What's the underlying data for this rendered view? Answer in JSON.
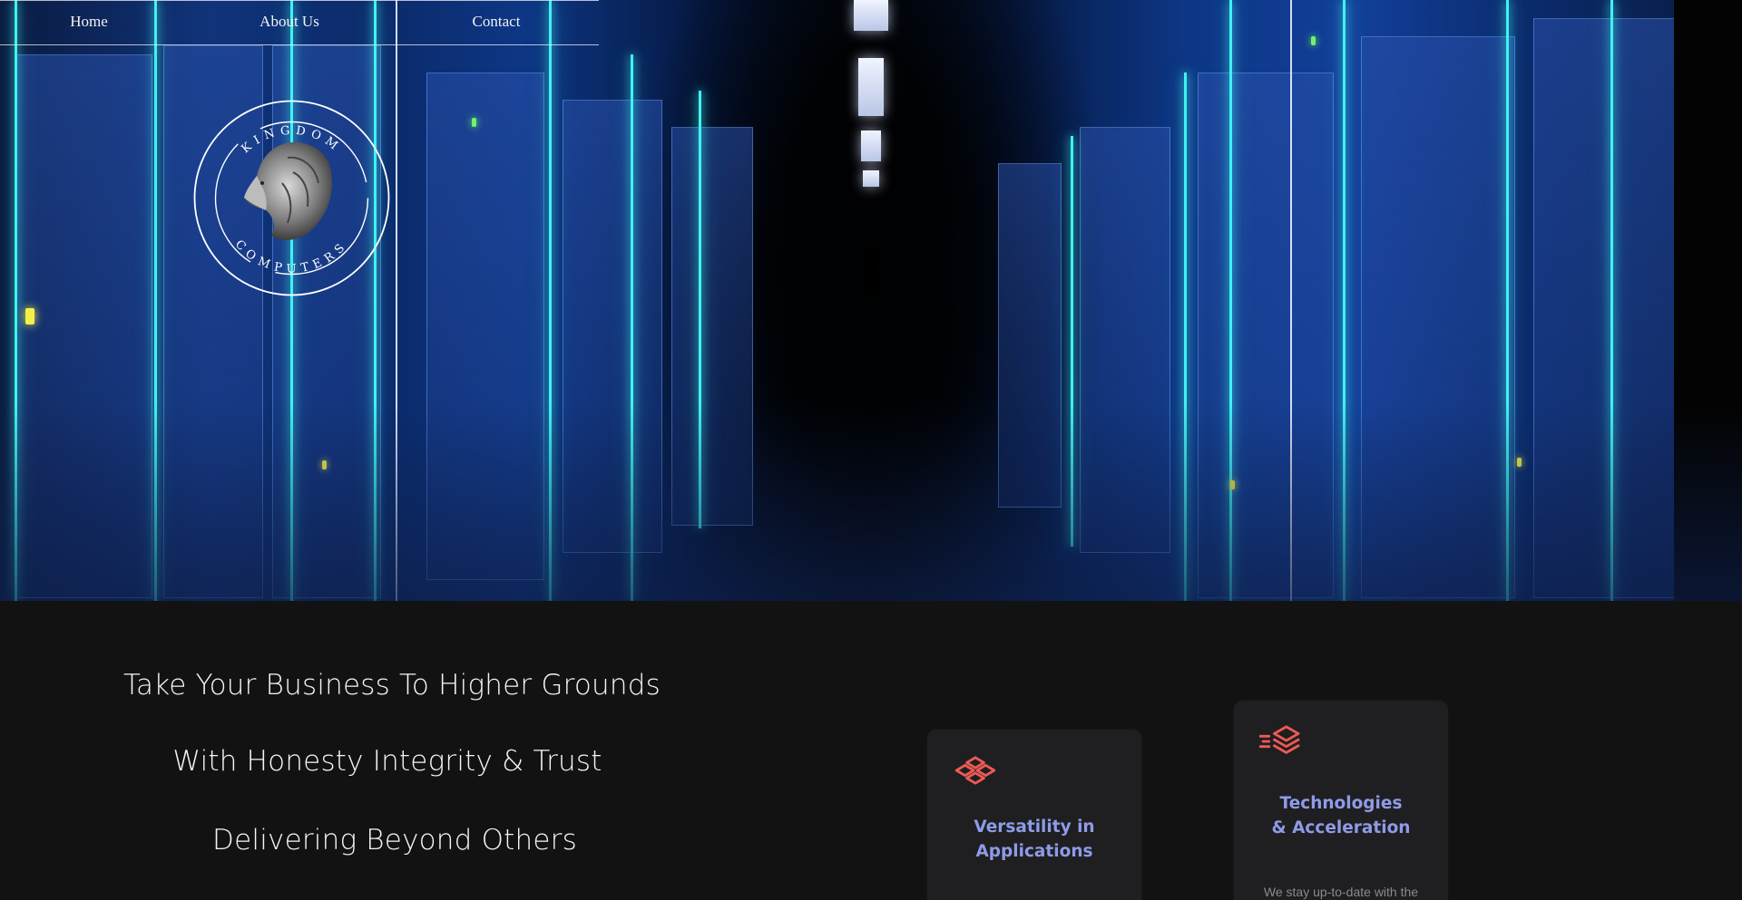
{
  "nav": {
    "items": [
      {
        "label": "Home"
      },
      {
        "label": "About Us"
      },
      {
        "label": "Contact"
      }
    ]
  },
  "logo": {
    "top_text": "KINGDOM",
    "bottom_text": "COMPUTERS",
    "icon": "lion-icon"
  },
  "hero": {
    "background": "server-room-image",
    "accent_color": "#3ff2f0"
  },
  "taglines": [
    "Take Your Business To Higher Grounds",
    "With Honesty Integrity & Trust",
    "Delivering Beyond Others"
  ],
  "cards": [
    {
      "icon": "stacked-diamonds-icon",
      "title": "Versatility in Applications",
      "text": ""
    },
    {
      "icon": "speed-layers-icon",
      "title": "Technologies & Acceleration",
      "text": "We stay up-to-date with the"
    }
  ],
  "colors": {
    "background": "#121212",
    "card_background": "#1f1f21",
    "card_title": "#8e9be8",
    "icon_accent": "#ee5a55"
  }
}
